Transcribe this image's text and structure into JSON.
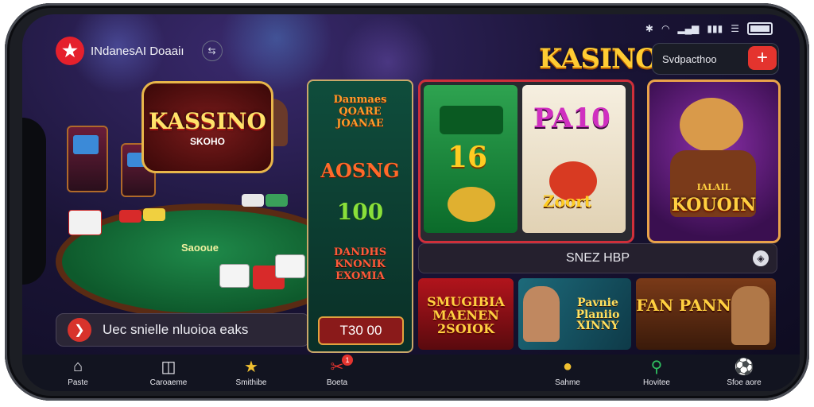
{
  "status_bar": {
    "icons": [
      "bluetooth-icon",
      "wifi-icon",
      "signal-icon",
      "battery-icon"
    ]
  },
  "header": {
    "brand_name": "INdanesAI Doaaiı",
    "logo_icon": "star-logo-icon",
    "title": "KASINO",
    "search_value": "Svdpacthoo",
    "add_label": "+"
  },
  "hero": {
    "logo_title": "KASSINO",
    "logo_subtitle": "SKOHO",
    "table_text": "Saooue",
    "cta_text": "Uec snielle nluoioa eaks",
    "cta_icon": "chevron-right-icon"
  },
  "middle_column": {
    "items": [
      {
        "label": "Danmaes QOARE JOANAE",
        "color": "#ff9a2a"
      },
      {
        "label": "AOSNG",
        "color": "#ff6a2a"
      },
      {
        "label": "100",
        "color": "#8ae03a"
      },
      {
        "label": "DANDHS KNONIK EXOMIA",
        "color": "#ff5a3a"
      }
    ],
    "price_label": "Т30 00"
  },
  "reels_card": {
    "left_value": "16",
    "right_top": "PA10",
    "right_bottom": "Zoort"
  },
  "mascot_card": {
    "top_label": "IALAIL",
    "label": "KOUOIN"
  },
  "banner": {
    "text": "SNEZ HBP",
    "icon": "swap-icon"
  },
  "thumbnails": [
    {
      "label": "SMUGIBIA MAENEN 2SOIOK",
      "colors": [
        "#ffd040"
      ]
    },
    {
      "label": "Pavnie Planiio XINNY",
      "colors": [
        "#ffe060"
      ]
    },
    {
      "label": "JUFAN PANNIEN",
      "colors": [
        "#ffd040"
      ]
    }
  ],
  "nav": {
    "items": [
      {
        "label": "Paste",
        "icon": "home-icon"
      },
      {
        "label": "Caroaeme",
        "icon": "cube-icon"
      },
      {
        "label": "Smithibe",
        "icon": "star-icon"
      },
      {
        "label": "Boeta",
        "icon": "slots-icon",
        "badge": "1"
      },
      {
        "label": "Sahme",
        "icon": "coin-icon"
      },
      {
        "label": "Hovitee",
        "icon": "search-icon"
      },
      {
        "label": "Sfoe aore",
        "icon": "soccer-icon"
      }
    ]
  }
}
